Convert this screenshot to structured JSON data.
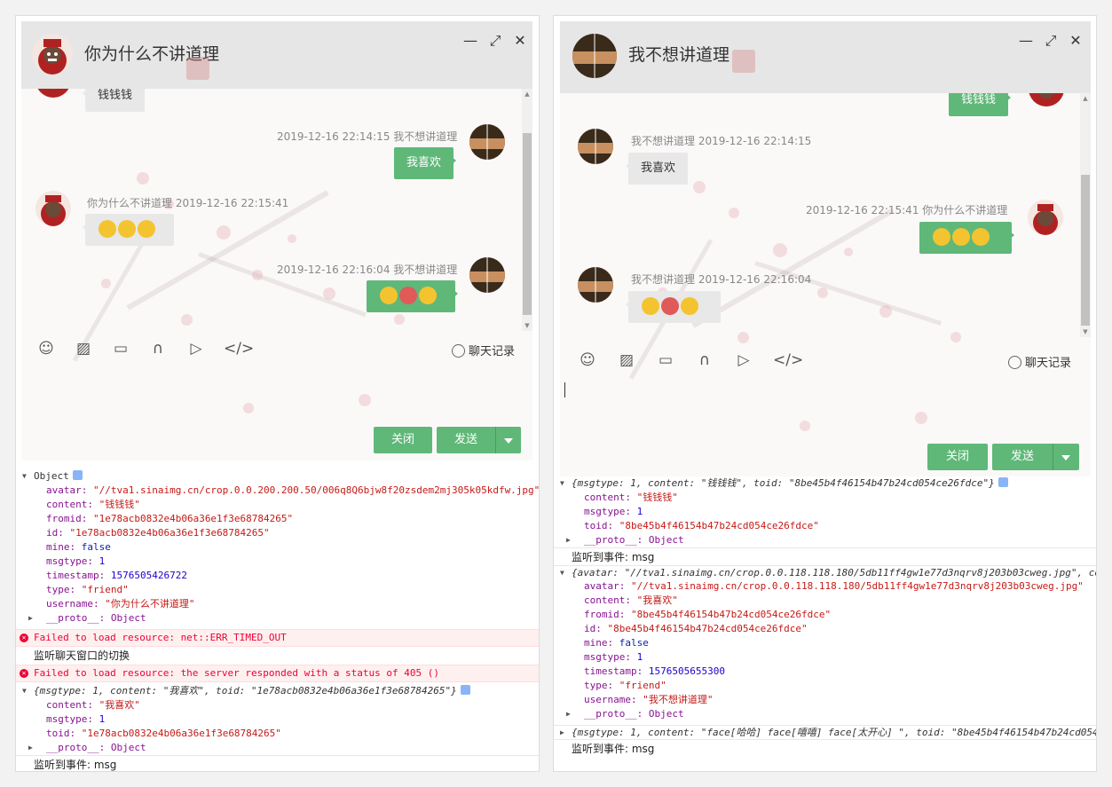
{
  "colors": {
    "accent": "#5fb878",
    "error": "#e03",
    "titlebar": "#e6e6e6"
  },
  "left": {
    "title": "你为什么不讲道理",
    "window_controls": [
      "—",
      "⤢",
      "✕"
    ],
    "messages": [
      {
        "text": "钱钱钱",
        "side": "them"
      },
      {
        "meta": "2019-12-16 22:14:15   我不想讲道理",
        "text": "我喜欢",
        "side": "me"
      },
      {
        "meta": "你为什么不讲道理    2019-12-16 22:15:41",
        "side": "them",
        "emoji": 3
      },
      {
        "meta": "2019-12-16 22:16:04   我不想讲道理",
        "side": "me",
        "emoji": 3
      }
    ],
    "history_label": "聊天记录",
    "close_label": "关闭",
    "send_label": "发送",
    "console": {
      "obj_label": "Object",
      "fields": [
        [
          "avatar: ",
          "\"//tva1.sinaimg.cn/crop.0.0.200.200.50/006q8Q6bjw8f20zsdem2mj305k05kdfw.jpg\""
        ],
        [
          "content: ",
          "\"钱钱钱\""
        ],
        [
          "fromid: ",
          "\"1e78acb0832e4b06a36e1f3e68784265\""
        ],
        [
          "id: ",
          "\"1e78acb0832e4b06a36e1f3e68784265\""
        ],
        [
          "mine: ",
          "false"
        ],
        [
          "msgtype: ",
          "1"
        ],
        [
          "timestamp: ",
          "1576505426722"
        ],
        [
          "type: ",
          "\"friend\""
        ],
        [
          "username: ",
          "\"你为什么不讲道理\""
        ]
      ],
      "proto": "__proto__: Object",
      "err1": "Failed to load resource: net::ERR_TIMED_OUT",
      "plain1": "监听聊天窗口的切换",
      "err2": "Failed to load resource: the server responded with a status of 405 ()",
      "obj2_summary": "{msgtype: 1, content: \"我喜欢\", toid: \"1e78acb0832e4b06a36e1f3e68784265\"}",
      "obj2_fields": [
        [
          "content: ",
          "\"我喜欢\""
        ],
        [
          "msgtype: ",
          "1"
        ],
        [
          "toid: ",
          "\"1e78acb0832e4b06a36e1f3e68784265\""
        ]
      ],
      "plain2": "监听到事件: msg"
    }
  },
  "right": {
    "title": "我不想讲道理",
    "window_controls": [
      "—",
      "⤢",
      "✕"
    ],
    "messages": [
      {
        "text": "钱钱钱",
        "side": "me"
      },
      {
        "meta": "我不想讲道理    2019-12-16 22:14:15",
        "text": "我喜欢",
        "side": "them"
      },
      {
        "meta": "2019-12-16 22:15:41   你为什么不讲道理",
        "side": "me",
        "emoji": 3
      },
      {
        "meta": "我不想讲道理    2019-12-16 22:16:04",
        "side": "them",
        "emoji": 3
      }
    ],
    "history_label": "聊天记录",
    "close_label": "关闭",
    "send_label": "发送",
    "console": {
      "obj1_summary": "{msgtype: 1, content: \"钱钱钱\", toid: \"8be45b4f46154b47b24cd054ce26fdce\"}",
      "obj1_fields": [
        [
          "content: ",
          "\"钱钱钱\""
        ],
        [
          "msgtype: ",
          "1"
        ],
        [
          "toid: ",
          "\"8be45b4f46154b47b24cd054ce26fdce\""
        ]
      ],
      "proto": "__proto__: Object",
      "plain1": "监听到事件: msg",
      "obj2_summary": "{avatar: \"//tva1.sinaimg.cn/crop.0.0.118.118.180/5db11ff4gw1e77d3nqrv8j203b03cweg.jpg\", con",
      "obj2_fields": [
        [
          "avatar: ",
          "\"//tva1.sinaimg.cn/crop.0.0.118.118.180/5db11ff4gw1e77d3nqrv8j203b03cweg.jpg\""
        ],
        [
          "content: ",
          "\"我喜欢\""
        ],
        [
          "fromid: ",
          "\"8be45b4f46154b47b24cd054ce26fdce\""
        ],
        [
          "id: ",
          "\"8be45b4f46154b47b24cd054ce26fdce\""
        ],
        [
          "mine: ",
          "false"
        ],
        [
          "msgtype: ",
          "1"
        ],
        [
          "timestamp: ",
          "1576505655300"
        ],
        [
          "type: ",
          "\"friend\""
        ],
        [
          "username: ",
          "\"我不想讲道理\""
        ]
      ],
      "obj3_summary": "{msgtype: 1, content: \"face[哈哈] face[嘻嘻] face[太开心] \", toid: \"8be45b4f46154b47b24cd054",
      "plain2": "监听到事件: msg"
    }
  }
}
